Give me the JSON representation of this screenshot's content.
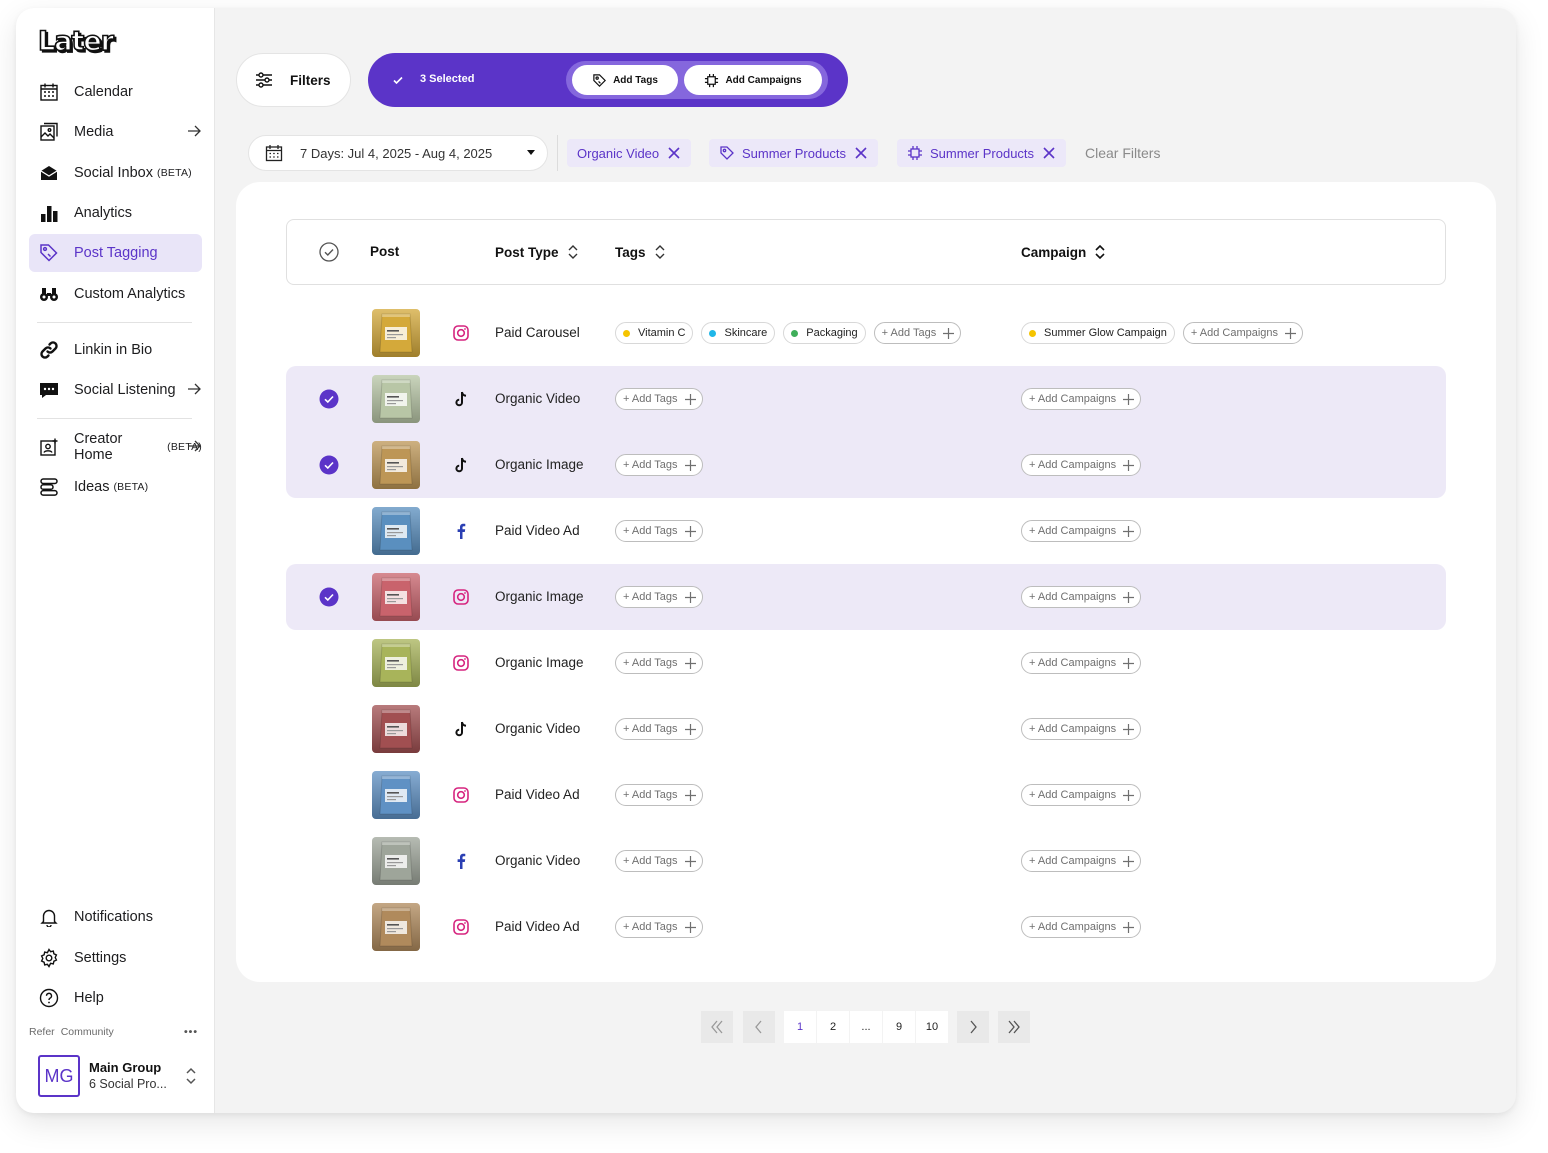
{
  "brand": {
    "logo_text": "Later",
    "accent": "#5b34c8",
    "accent_light": "#ede9f7"
  },
  "sidebar": {
    "items": [
      {
        "label": "Calendar",
        "icon": "calendar-icon"
      },
      {
        "label": "Media",
        "icon": "image-icon",
        "arrow": true
      },
      {
        "label": "Social Inbox",
        "beta": "(BETA)",
        "icon": "inbox-icon"
      },
      {
        "label": "Analytics",
        "icon": "bar-chart-icon"
      },
      {
        "label": "Post Tagging",
        "icon": "tag-icon",
        "active": true
      },
      {
        "label": "Custom Analytics",
        "icon": "binoculars-icon"
      },
      {
        "label": "Linkin in Bio",
        "icon": "link-icon"
      },
      {
        "label": "Social Listening",
        "icon": "chat-icon",
        "arrow": true
      },
      {
        "label": "Creator Home",
        "beta": "(BETA)",
        "icon": "creator-icon",
        "arrow": true
      },
      {
        "label": "Ideas",
        "beta": "(BETA)",
        "icon": "ideas-icon"
      }
    ],
    "bottom_items": [
      {
        "label": "Notifications",
        "icon": "bell-icon"
      },
      {
        "label": "Settings",
        "icon": "gear-icon"
      },
      {
        "label": "Help",
        "icon": "help-icon"
      }
    ],
    "footer_links": [
      "Refer",
      "Community"
    ],
    "more": "•••",
    "account": {
      "initials": "MG",
      "name": "Main Group",
      "sub": "6 Social Pro..."
    }
  },
  "toolbar": {
    "filters_label": "Filters",
    "selected_label": "3 Selected",
    "add_tags_label": "Add Tags",
    "add_campaigns_label": "Add Campaigns"
  },
  "filters": {
    "date_range": "7 Days: Jul 4, 2025 - Aug 4, 2025",
    "chips": [
      {
        "label": "Organic Video",
        "icon": ""
      },
      {
        "label": "Summer Products",
        "icon": "tag-icon"
      },
      {
        "label": "Summer Products",
        "icon": "campaign-icon"
      }
    ],
    "clear_label": "Clear Filters"
  },
  "table": {
    "columns": {
      "post": "Post",
      "post_type": "Post Type",
      "tags": "Tags",
      "campaign": "Campaign"
    },
    "add_tags_label": "+ Add Tags",
    "add_campaigns_label": "+ Add Campaigns",
    "rows": [
      {
        "selected": false,
        "platform": "instagram",
        "post_type": "Paid Carousel",
        "thumb_color": "#d4a93a",
        "tags": [
          {
            "label": "Vitamin C",
            "color": "#f5c400"
          },
          {
            "label": "Skincare",
            "color": "#1fb6e8"
          },
          {
            "label": "Packaging",
            "color": "#3fae5a"
          }
        ],
        "campaigns": [
          {
            "label": "Summer Glow Campaign",
            "color": "#f5c400"
          }
        ]
      },
      {
        "selected": true,
        "platform": "tiktok",
        "post_type": "Organic Video",
        "thumb_color": "#b8c6a6",
        "tags": [],
        "campaigns": []
      },
      {
        "selected": true,
        "platform": "tiktok",
        "post_type": "Organic Image",
        "thumb_color": "#bd9656",
        "tags": [],
        "campaigns": []
      },
      {
        "selected": false,
        "platform": "facebook",
        "post_type": "Paid Video Ad",
        "thumb_color": "#5a8fbf",
        "tags": [],
        "campaigns": []
      },
      {
        "selected": true,
        "platform": "instagram",
        "post_type": "Organic Image",
        "thumb_color": "#c9636c",
        "tags": [],
        "campaigns": []
      },
      {
        "selected": false,
        "platform": "instagram",
        "post_type": "Organic Image",
        "thumb_color": "#a8b45a",
        "tags": [],
        "campaigns": []
      },
      {
        "selected": false,
        "platform": "tiktok",
        "post_type": "Organic Video",
        "thumb_color": "#a14f51",
        "tags": [],
        "campaigns": []
      },
      {
        "selected": false,
        "platform": "instagram",
        "post_type": "Paid Video Ad",
        "thumb_color": "#5f91c4",
        "tags": [],
        "campaigns": []
      },
      {
        "selected": false,
        "platform": "facebook",
        "post_type": "Organic Video",
        "thumb_color": "#9ea59a",
        "tags": [],
        "campaigns": []
      },
      {
        "selected": false,
        "platform": "instagram",
        "post_type": "Paid Video Ad",
        "thumb_color": "#b08a5c",
        "tags": [],
        "campaigns": []
      }
    ]
  },
  "pagination": {
    "pages": [
      "1",
      "2",
      "...",
      "9",
      "10"
    ],
    "current": "1"
  }
}
